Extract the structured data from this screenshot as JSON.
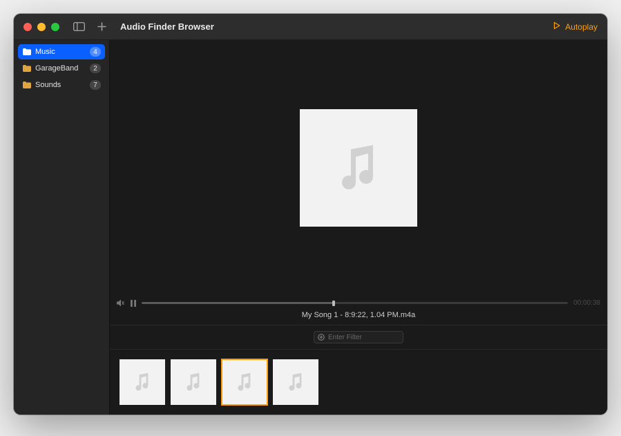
{
  "window": {
    "title": "Audio Finder Browser",
    "autoplay_label": "Autoplay"
  },
  "sidebar": {
    "items": [
      {
        "label": "Music",
        "count": "4",
        "selected": true
      },
      {
        "label": "GarageBand",
        "count": "2",
        "selected": false
      },
      {
        "label": "Sounds",
        "count": "7",
        "selected": false
      }
    ]
  },
  "player": {
    "current_file": "My Song 1 - 8:9:22, 1.04 PM.m4a",
    "time_elapsed": "00:00:38",
    "progress_percent": 45
  },
  "filter": {
    "placeholder": "Enter Filter"
  },
  "thumbnails": {
    "count": 4,
    "selected_index": 2
  },
  "icons": {
    "folder": "folder-icon",
    "music_note": "music-note-icon",
    "sidebar_toggle": "sidebar-toggle-icon",
    "plus": "plus-icon",
    "play_outline": "play-outline-icon",
    "mute": "volume-mute-icon",
    "pause": "pause-icon",
    "filter_plus": "filter-add-icon"
  }
}
